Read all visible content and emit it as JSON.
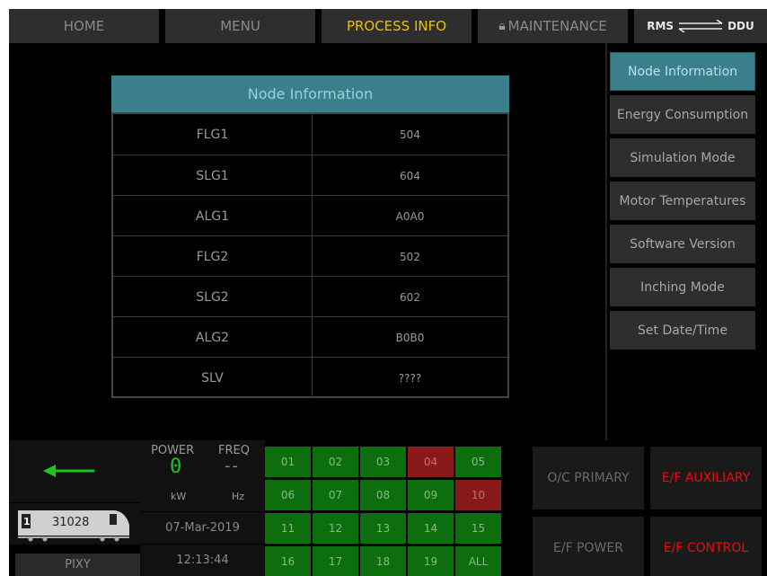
{
  "nav": {
    "home": "HOME",
    "menu": "MENU",
    "process_info": "PROCESS INFO",
    "maintenance": "MAINTENANCE",
    "rms": "RMS",
    "ddu": "DDU"
  },
  "node_table": {
    "title": "Node Information",
    "rows": [
      {
        "name": "FLG1",
        "value": "504"
      },
      {
        "name": "SLG1",
        "value": "604"
      },
      {
        "name": "ALG1",
        "value": "A0A0"
      },
      {
        "name": "FLG2",
        "value": "502"
      },
      {
        "name": "SLG2",
        "value": "602"
      },
      {
        "name": "ALG2",
        "value": "B0B0"
      },
      {
        "name": "SLV",
        "value": "????"
      }
    ]
  },
  "side_menu": [
    "Node Information",
    "Energy Consumption",
    "Simulation Mode",
    "Motor Temperatures",
    "Software Version",
    "Inching Mode",
    "Set Date/Time"
  ],
  "bottom": {
    "power_label": "POWER",
    "freq_label": "FREQ",
    "power_value": "0",
    "freq_value": "--",
    "power_unit": "kW",
    "freq_unit": "Hz",
    "date": "07-Mar-2019",
    "time": "12:13:44",
    "loco_number": "31028",
    "cab": "1",
    "pixy": "PIXY",
    "grid": [
      "01",
      "02",
      "03",
      "04",
      "05",
      "06",
      "07",
      "08",
      "09",
      "10",
      "11",
      "12",
      "13",
      "14",
      "15",
      "16",
      "17",
      "18",
      "19",
      "ALL"
    ],
    "grid_red": [
      "04",
      "10"
    ],
    "status": {
      "oc_primary": "O/C PRIMARY",
      "ef_auxiliary": "E/F AUXILIARY",
      "ef_power": "E/F POWER",
      "ef_control": "E/F CONTROL"
    }
  },
  "colors": {
    "accent_teal": "#3c7f8c",
    "active_nav": "#f0c000",
    "fault_red": "#e01010",
    "ok_green": "#0d6e0d"
  }
}
